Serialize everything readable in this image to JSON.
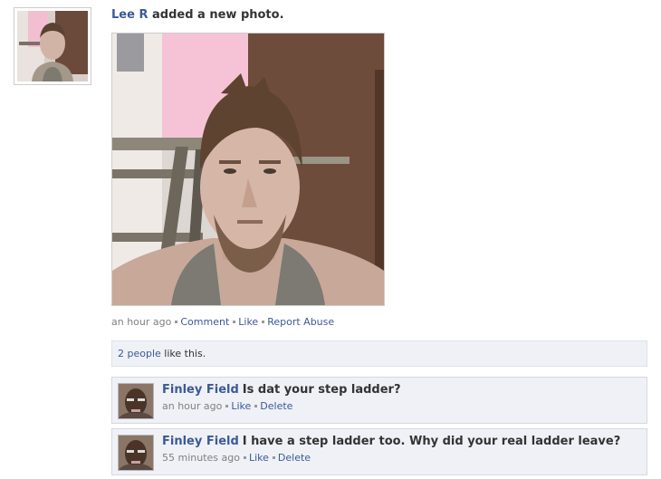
{
  "story": {
    "actor": "Lee R",
    "action": "added a new photo.",
    "timestamp": "an hour ago",
    "actions": [
      "Comment",
      "Like",
      "Report Abuse"
    ]
  },
  "likes": {
    "count_link": "2 people",
    "suffix": "like this."
  },
  "comments": [
    {
      "author": "Finley Field",
      "text": "Is dat your step ladder?",
      "timestamp": "an hour ago",
      "actions": [
        "Like",
        "Delete"
      ]
    },
    {
      "author": "Finley Field",
      "text": "I have a step ladder too. Why did your real ladder leave?",
      "timestamp": "55 minutes ago",
      "actions": [
        "Like",
        "Delete"
      ]
    }
  ],
  "colors": {
    "link": "#3b5998",
    "comment_bg": "#eff1f6",
    "meta_text": "#808080"
  }
}
